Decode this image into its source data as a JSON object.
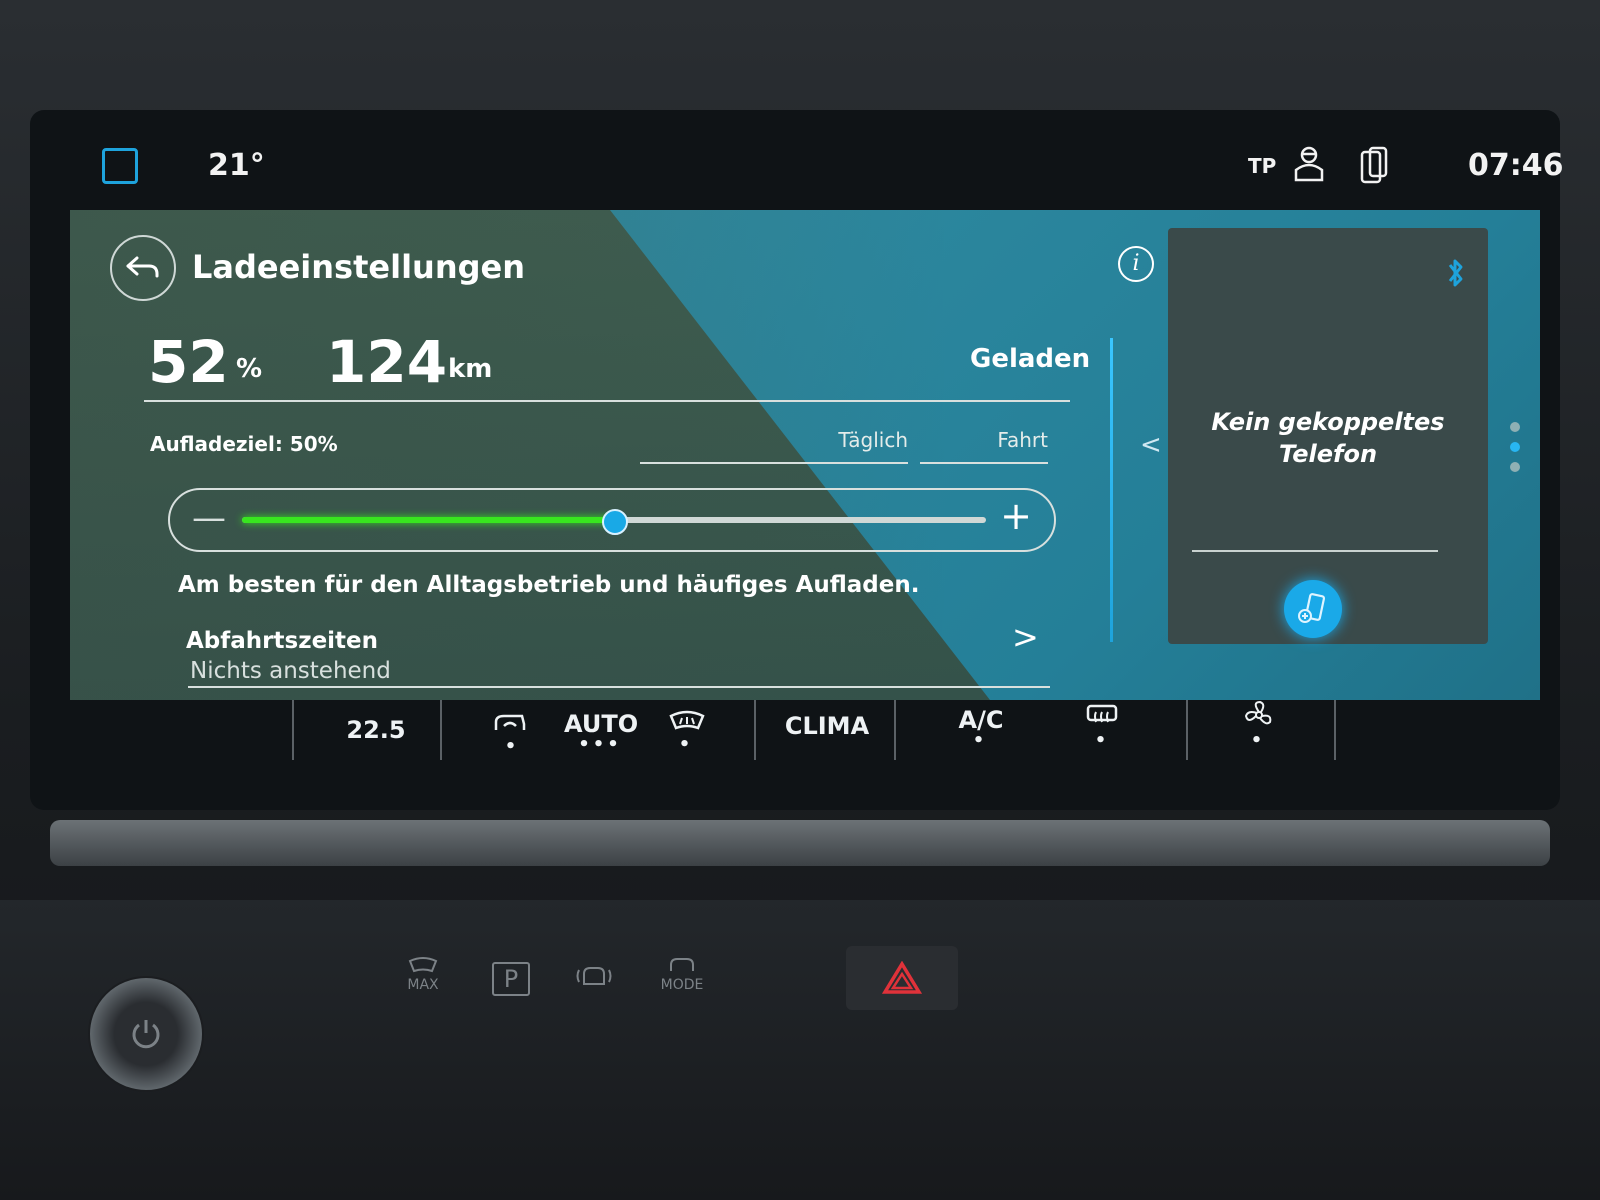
{
  "status_bar": {
    "outside_temp": "21°",
    "tp_label": "TP",
    "time": "07:46"
  },
  "header": {
    "title": "Ladeeinstellungen"
  },
  "battery": {
    "percent": "52",
    "percent_unit": "%",
    "range": "124",
    "range_unit": "km",
    "status": "Geladen"
  },
  "charge_target": {
    "label": "Aufladeziel: 50%",
    "slider_value_pct": 50,
    "tabs": [
      "Täglich",
      "Fahrt"
    ]
  },
  "description": "Am besten für den Alltagsbetrieb und häufiges Aufladen.",
  "departure": {
    "title": "Abfahrtszeiten",
    "subtitle": "Nichts anstehend"
  },
  "phone_panel": {
    "message": "Kein gekoppeltes Telefon"
  },
  "climate": {
    "set_temp": "22.5",
    "auto_label": "AUTO",
    "clima_label": "CLIMA",
    "ac_label": "A/C"
  },
  "console": {
    "max_label": "MAX",
    "park_label": "P",
    "mode_label": "MODE"
  },
  "colors": {
    "accent_blue": "#1ea3dc",
    "slider_green": "#38e61f",
    "hazard_red": "#e0323a"
  }
}
